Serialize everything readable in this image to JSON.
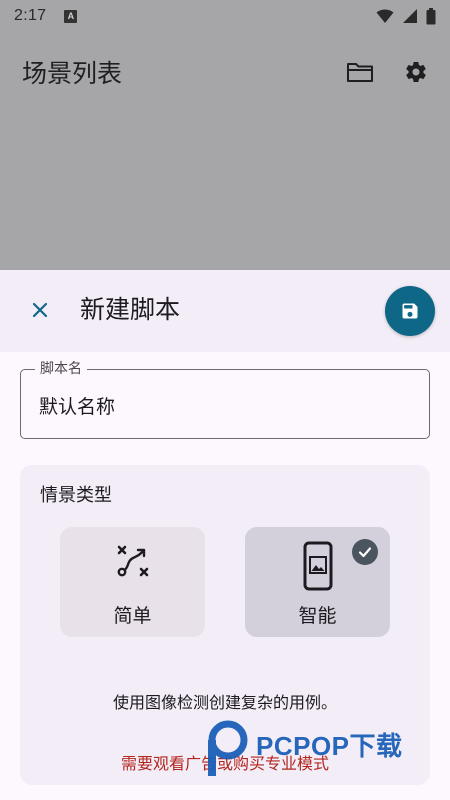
{
  "status_bar": {
    "time": "2:17",
    "notification_letter": "A"
  },
  "app_bar": {
    "title": "场景列表",
    "actions": [
      "folder-icon",
      "gear-icon"
    ]
  },
  "sheet": {
    "title": "新建脚本",
    "close_icon": "close-icon",
    "save_icon": "save-icon",
    "accent_color": "#0e6787"
  },
  "name_field": {
    "label": "脚本名",
    "value": "默认名称"
  },
  "scenario_card": {
    "title": "情景类型",
    "options": [
      {
        "label": "简单",
        "icon": "route-icon",
        "selected": false
      },
      {
        "label": "智能",
        "icon": "phone-image-icon",
        "selected": true
      }
    ],
    "description": "使用图像检测创建复杂的用例。",
    "warning": "需要观看广告或购买专业模式",
    "warning_color": "#b3261e"
  },
  "watermark": {
    "text": "PCPOP下载"
  }
}
